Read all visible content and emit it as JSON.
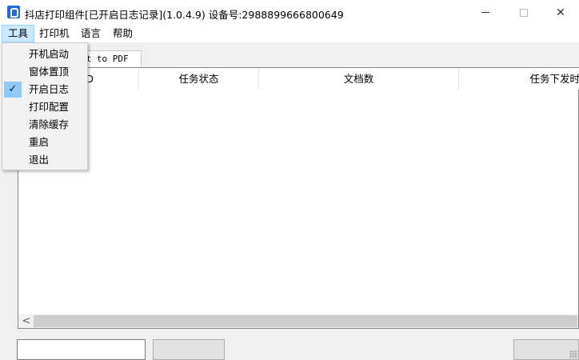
{
  "window": {
    "title": "抖店打印组件[已开启日志记录](1.0.4.9) 设备号:2988899666800649",
    "minimize_glyph": "—",
    "maximize_glyph": "☐",
    "close_glyph": "✕"
  },
  "menubar": {
    "items": [
      {
        "label": "工具",
        "active": true
      },
      {
        "label": "打印机",
        "active": false
      },
      {
        "label": "语言",
        "active": false
      },
      {
        "label": "帮助",
        "active": false
      }
    ]
  },
  "tabs": [
    {
      "label": "Microsoft Print to PDF",
      "visible_label": "nt to PDF",
      "selected": true
    }
  ],
  "table": {
    "columns": [
      "ID",
      "任务状态",
      "文档数",
      "任务下发时间"
    ],
    "visible_column_text": [
      "D",
      "任务状态",
      "文档数",
      "任务下发时"
    ],
    "rows": []
  },
  "scrollbar": {
    "left_arrow": "<"
  },
  "tools_menu": {
    "items": [
      {
        "label": "开机启动",
        "checked": false
      },
      {
        "label": "窗体置顶",
        "checked": false
      },
      {
        "label": "开启日志",
        "checked": true
      },
      {
        "label": "打印配置",
        "checked": false
      },
      {
        "label": "清除缓存",
        "checked": false
      },
      {
        "label": "重启",
        "checked": false
      },
      {
        "label": "退出",
        "checked": false
      }
    ],
    "check_glyph": "✓"
  },
  "colors": {
    "menu_active_bg": "#cce8ff",
    "check_bg": "#90c8f6",
    "app_icon": "#1f6fd6"
  }
}
